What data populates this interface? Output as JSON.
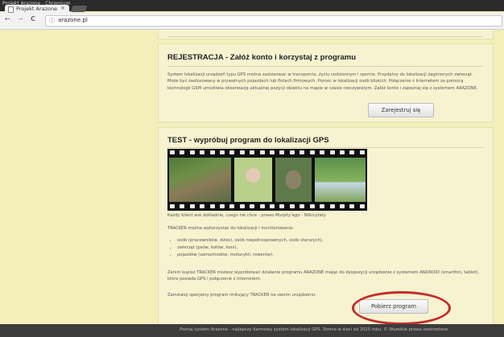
{
  "window": {
    "title": "Projekt Arazone - Chromium"
  },
  "tabs": [
    {
      "label": "Projekt Arazone",
      "close": "×"
    }
  ],
  "nav": {
    "back": "←",
    "forward": "→",
    "reload": "C"
  },
  "address_bar": {
    "url": "arazone.pl",
    "info": "ⓘ"
  },
  "registration": {
    "heading": "REJESTRACJA - Załóż konto i korzystaj z programu",
    "text": "System lokalizacji urządzeń typu GPS można zastosować w transporcie, życiu codziennym i sporcie. Przydatny do lokalizacji zaginionych zwierząt. Może być zastosowany w prywatnych pojazdach lub flotach firmowych. Pomoc w lokalizacji osób bliskich. Połączenie z Internetem za pomocą technologii GSM umożliwia obserwację aktualnej pozycji obiektu na mapie w czasie rzeczywistym. Załóż konto i zapoznaj się z systemem ARAZONE.",
    "button": "Zarejestruj się"
  },
  "test": {
    "heading": "TEST - wypróbuj program do lokalizacji GPS",
    "caption": "Każdy klient wie dokładnie, czego nie chce -",
    "caption_quote": "prawo Murphy'ego",
    "caption_source": "- Wikicytaty",
    "intro": "TRACKER można wykorzystać do lokalizacji i monitorowania:",
    "items": [
      "osób (pracowników, dzieci, osób niepełnosprawnych, osób starszych),",
      "zwierząt (psów, kotów, koni),",
      "pojazdów (samochodów, motocykli, rowerów)."
    ],
    "para2": "Zanim kupisz TRACKER możesz wypróbować działanie programu ARAZONE mając do dyspozycji urządzenie z systemem ANDROID (smartfon, tablet), które posiada GPS i połączenie z internetem.",
    "para3": "Zainstaluj specjalny program imitujący TRACKER na swoim urządzeniu:",
    "button": "Pobierz program"
  },
  "footer": {
    "text": "Poznaj system Arazone - najlepszy darmowy system lokalizacji GPS. Strona w sieci od 2015 roku. © Wszelkie prawa zastrzeżone."
  },
  "colors": {
    "page_bg": "#f3efba",
    "card_bg": "#f7f3d0",
    "highlight": "#c42b2b",
    "footer_bg": "#3c3c3c"
  },
  "icons": [
    "page-icon",
    "close-icon",
    "back-arrow-icon",
    "forward-arrow-icon",
    "reload-icon",
    "info-icon"
  ]
}
